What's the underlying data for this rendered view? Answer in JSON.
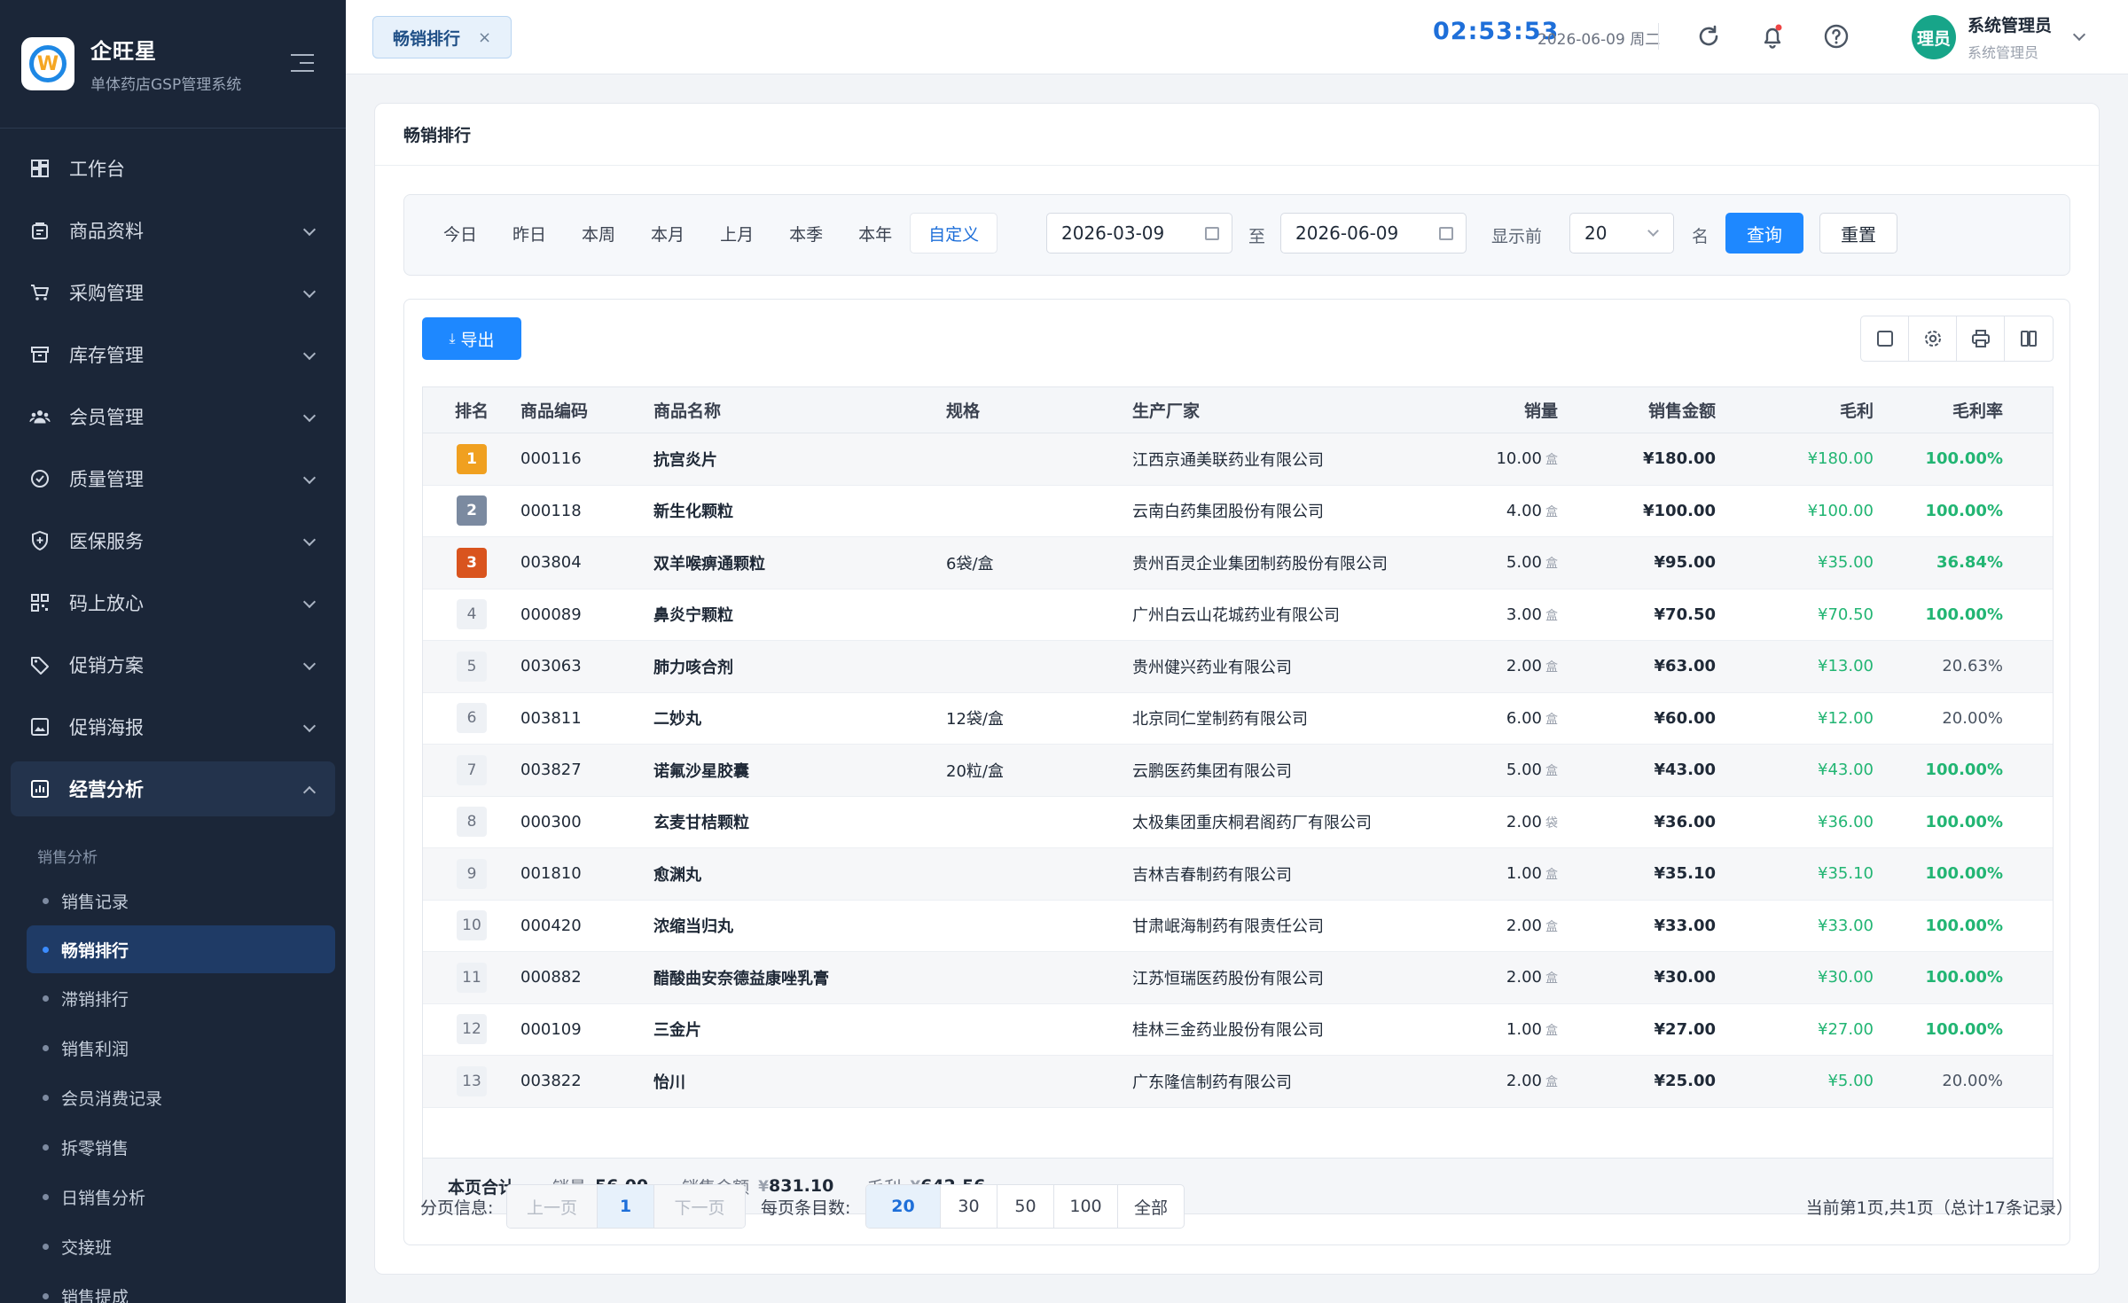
{
  "brand": {
    "title": "企旺星",
    "subtitle": "单体药店GSP管理系统"
  },
  "sidebar": {
    "items": [
      {
        "label": "工作台",
        "icon": "dashboard-icon",
        "expandable": false
      },
      {
        "label": "商品资料",
        "icon": "product-icon",
        "expandable": true
      },
      {
        "label": "采购管理",
        "icon": "cart-icon",
        "expandable": true
      },
      {
        "label": "库存管理",
        "icon": "inventory-icon",
        "expandable": true
      },
      {
        "label": "会员管理",
        "icon": "members-icon",
        "expandable": true
      },
      {
        "label": "质量管理",
        "icon": "quality-icon",
        "expandable": true
      },
      {
        "label": "医保服务",
        "icon": "insurance-icon",
        "expandable": true
      },
      {
        "label": "码上放心",
        "icon": "qrcode-icon",
        "expandable": true
      },
      {
        "label": "促销方案",
        "icon": "tag-icon",
        "expandable": true
      },
      {
        "label": "促销海报",
        "icon": "poster-icon",
        "expandable": true
      },
      {
        "label": "经营分析",
        "icon": "analytics-icon",
        "expandable": true,
        "active": true
      }
    ],
    "sub_group": "销售分析",
    "sub_items": [
      "销售记录",
      "畅销排行",
      "滞销排行",
      "销售利润",
      "会员消费记录",
      "拆零销售",
      "日销售分析",
      "交接班",
      "销售提成"
    ]
  },
  "header": {
    "tab_label": "畅销排行",
    "tab_close": "×",
    "time": "02:53:53",
    "date": "2026-06-09 周二",
    "user_avatar": "理员",
    "user_name": "系统管理员",
    "user_role": "系统管理员"
  },
  "page": {
    "title": "畅销排行"
  },
  "filter": {
    "periods": [
      "今日",
      "昨日",
      "本周",
      "本月",
      "上月",
      "本季",
      "本年",
      "自定义"
    ],
    "selected_period": "自定义",
    "start_date": "2026-03-09",
    "to_label": "至",
    "end_date": "2026-06-09",
    "show_top_label": "显示前",
    "top_n": "20",
    "top_suffix": "名",
    "query_label": "查询",
    "reset_label": "重置"
  },
  "toolbar": {
    "export_label": "导出"
  },
  "table": {
    "columns": [
      "排名",
      "商品编码",
      "商品名称",
      "规格",
      "生产厂家",
      "销量",
      "销售金额",
      "毛利",
      "毛利率"
    ],
    "rows": [
      {
        "rank": "1",
        "code": "000116",
        "name": "抗宫炎片",
        "spec": "",
        "mfr": "江西京通美联药业有限公司",
        "qty": "10.00",
        "unit": "盒",
        "amount": "¥180.00",
        "profit": "¥180.00",
        "rate": "100.00%"
      },
      {
        "rank": "2",
        "code": "000118",
        "name": "新生化颗粒",
        "spec": "",
        "mfr": "云南白药集团股份有限公司",
        "qty": "4.00",
        "unit": "盒",
        "amount": "¥100.00",
        "profit": "¥100.00",
        "rate": "100.00%"
      },
      {
        "rank": "3",
        "code": "003804",
        "name": "双羊喉痹通颗粒",
        "spec": "6袋/盒",
        "mfr": "贵州百灵企业集团制药股份有限公司",
        "qty": "5.00",
        "unit": "盒",
        "amount": "¥95.00",
        "profit": "¥35.00",
        "rate": "36.84%"
      },
      {
        "rank": "4",
        "code": "000089",
        "name": "鼻炎宁颗粒",
        "spec": "",
        "mfr": "广州白云山花城药业有限公司",
        "qty": "3.00",
        "unit": "盒",
        "amount": "¥70.50",
        "profit": "¥70.50",
        "rate": "100.00%"
      },
      {
        "rank": "5",
        "code": "003063",
        "name": "肺力咳合剂",
        "spec": "",
        "mfr": "贵州健兴药业有限公司",
        "qty": "2.00",
        "unit": "盒",
        "amount": "¥63.00",
        "profit": "¥13.00",
        "rate": "20.63%"
      },
      {
        "rank": "6",
        "code": "003811",
        "name": "二妙丸",
        "spec": "12袋/盒",
        "mfr": "北京同仁堂制药有限公司",
        "qty": "6.00",
        "unit": "盒",
        "amount": "¥60.00",
        "profit": "¥12.00",
        "rate": "20.00%"
      },
      {
        "rank": "7",
        "code": "003827",
        "name": "诺氟沙星胶囊",
        "spec": "20粒/盒",
        "mfr": "云鹏医药集团有限公司",
        "qty": "5.00",
        "unit": "盒",
        "amount": "¥43.00",
        "profit": "¥43.00",
        "rate": "100.00%"
      },
      {
        "rank": "8",
        "code": "000300",
        "name": "玄麦甘桔颗粒",
        "spec": "",
        "mfr": "太极集团重庆桐君阁药厂有限公司",
        "qty": "2.00",
        "unit": "袋",
        "amount": "¥36.00",
        "profit": "¥36.00",
        "rate": "100.00%"
      },
      {
        "rank": "9",
        "code": "001810",
        "name": "愈渊丸",
        "spec": "",
        "mfr": "吉林吉春制药有限公司",
        "qty": "1.00",
        "unit": "盒",
        "amount": "¥35.10",
        "profit": "¥35.10",
        "rate": "100.00%"
      },
      {
        "rank": "10",
        "code": "000420",
        "name": "浓缩当归丸",
        "spec": "",
        "mfr": "甘肃岷海制药有限责任公司",
        "qty": "2.00",
        "unit": "盒",
        "amount": "¥33.00",
        "profit": "¥33.00",
        "rate": "100.00%"
      },
      {
        "rank": "11",
        "code": "000882",
        "name": "醋酸曲安奈德益康唑乳膏",
        "spec": "",
        "mfr": "江苏恒瑞医药股份有限公司",
        "qty": "2.00",
        "unit": "盒",
        "amount": "¥30.00",
        "profit": "¥30.00",
        "rate": "100.00%"
      },
      {
        "rank": "12",
        "code": "000109",
        "name": "三金片",
        "spec": "",
        "mfr": "桂林三金药业股份有限公司",
        "qty": "1.00",
        "unit": "盒",
        "amount": "¥27.00",
        "profit": "¥27.00",
        "rate": "100.00%"
      },
      {
        "rank": "13",
        "code": "003822",
        "name": "怡川",
        "spec": "",
        "mfr": "广东隆信制药有限公司",
        "qty": "2.00",
        "unit": "盒",
        "amount": "¥25.00",
        "profit": "¥5.00",
        "rate": "20.00%"
      }
    ]
  },
  "totals": {
    "title": "本页合计",
    "qty_label": "销量",
    "qty": "56.00",
    "amount_label": "销售金额",
    "amount_currency": "¥",
    "amount": "831.10",
    "profit_label": "毛利",
    "profit_currency": "¥",
    "profit": "642.56"
  },
  "pagination": {
    "label": "分页信息:",
    "prev": "上一页",
    "current": "1",
    "next": "下一页",
    "size_label": "每页条目数:",
    "sizes": [
      "20",
      "30",
      "50",
      "100",
      "全部"
    ],
    "selected_size": "20",
    "info": "当前第1页,共1页（总计17条记录）"
  },
  "colors": {
    "primary": "#1e88ff",
    "sidebar_bg": "#1b2638",
    "profit_green": "#22b573",
    "rank_gold": "#f0a020",
    "rank_silver": "#7b8aa0",
    "rank_bronze": "#d9541e"
  }
}
